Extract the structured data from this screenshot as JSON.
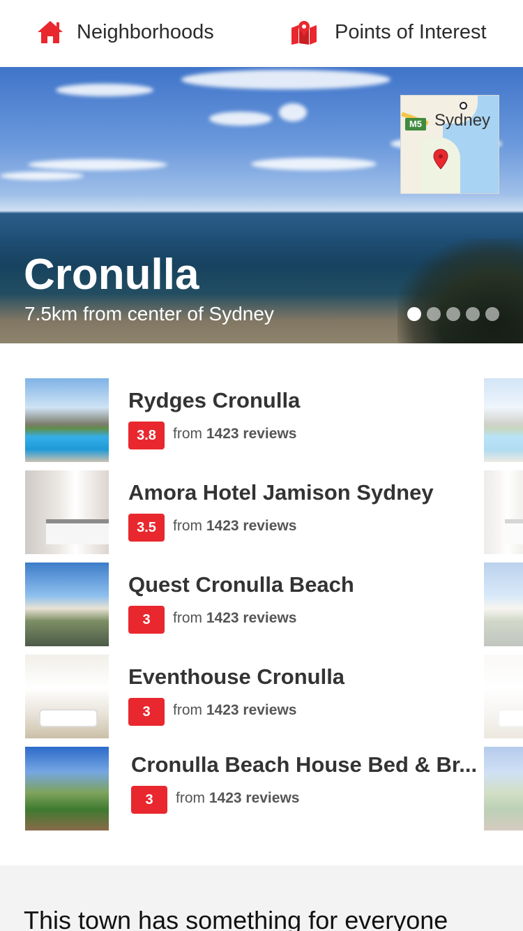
{
  "nav": {
    "neighborhoods_label": "Neighborhoods",
    "poi_label": "Points of Interest",
    "accent_color": "#e8282e"
  },
  "hero": {
    "title": "Cronulla",
    "subtitle": "7.5km from center of Sydney",
    "map": {
      "city_label": "Sydney",
      "road_label": "M5"
    },
    "carousel": {
      "pages": 5,
      "active_index": 0
    }
  },
  "hotels": [
    {
      "name": "Rydges Cronulla",
      "rating": "3.8",
      "reviews_prefix": "from",
      "reviews_count": "1423 reviews"
    },
    {
      "name": "Amora Hotel Jamison Sydney",
      "rating": "3.5",
      "reviews_prefix": "from",
      "reviews_count": "1423 reviews"
    },
    {
      "name": "Quest Cronulla Beach",
      "rating": "3",
      "reviews_prefix": "from",
      "reviews_count": "1423 reviews"
    },
    {
      "name": "Eventhouse Cronulla",
      "rating": "3",
      "reviews_prefix": "from",
      "reviews_count": "1423 reviews"
    },
    {
      "name": "Cronulla Beach House Bed & Br...",
      "rating": "3",
      "reviews_prefix": "from",
      "reviews_count": "1423 reviews"
    }
  ],
  "bottom": {
    "title": "This town has something for everyone"
  }
}
